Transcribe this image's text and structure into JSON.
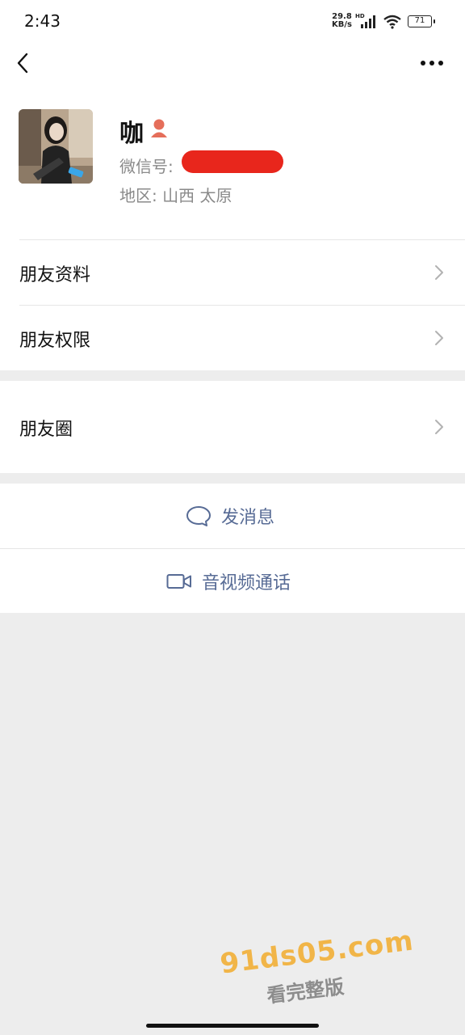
{
  "status_bar": {
    "time": "2:43",
    "net_speed_value": "29.8",
    "net_speed_unit": "KB/s",
    "hd": "HD",
    "battery": "71"
  },
  "profile": {
    "name": "咖",
    "wechat_id_label": "微信号:",
    "region": "地区:  山西  太原",
    "gender_icon": "female-person-icon",
    "colors": {
      "gender": "#e56e5a",
      "redaction": "#e8261c"
    }
  },
  "rows": [
    {
      "label": "朋友资料"
    },
    {
      "label": "朋友权限"
    },
    {
      "label": "朋友圈"
    }
  ],
  "actions": {
    "message": "发消息",
    "call": "音视频通话",
    "accent_color": "#576b95"
  },
  "watermark": {
    "line1": "91ds05.com",
    "line2": "看完整版"
  }
}
